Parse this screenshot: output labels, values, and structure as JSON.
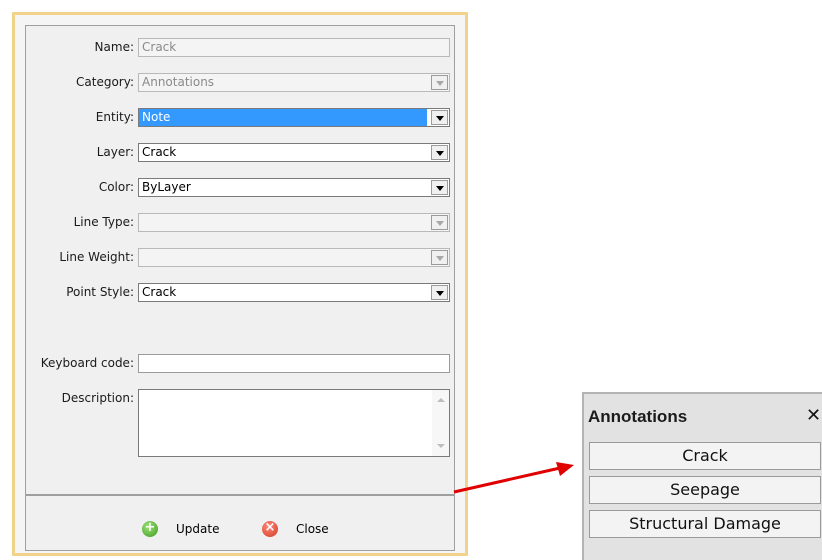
{
  "form": {
    "name": {
      "label": "Name:",
      "value": "Crack"
    },
    "category": {
      "label": "Category:",
      "value": "Annotations"
    },
    "entity": {
      "label": "Entity:",
      "value": "Note"
    },
    "layer": {
      "label": "Layer:",
      "value": "Crack"
    },
    "color": {
      "label": "Color:",
      "value": "ByLayer"
    },
    "line_type": {
      "label": "Line Type:",
      "value": ""
    },
    "line_weight": {
      "label": "Line Weight:",
      "value": ""
    },
    "point_style": {
      "label": "Point Style:",
      "value": "Crack"
    },
    "keyboard_code": {
      "label": "Keyboard code:",
      "value": ""
    },
    "description": {
      "label": "Description:",
      "value": ""
    }
  },
  "buttons": {
    "update": {
      "label": "Update",
      "icon": "plus-circle-icon",
      "color": "#3f9a1c"
    },
    "close": {
      "label": "Close",
      "icon": "x-circle-icon",
      "color": "#d23a24"
    }
  },
  "annotations_panel": {
    "title": "Annotations",
    "close_glyph": "✕",
    "items": [
      "Crack",
      "Seepage",
      "Structural Damage"
    ]
  },
  "colors": {
    "dialog_border": "#f2d38b",
    "selection": "#3399ff",
    "arrow": "#e00000"
  }
}
